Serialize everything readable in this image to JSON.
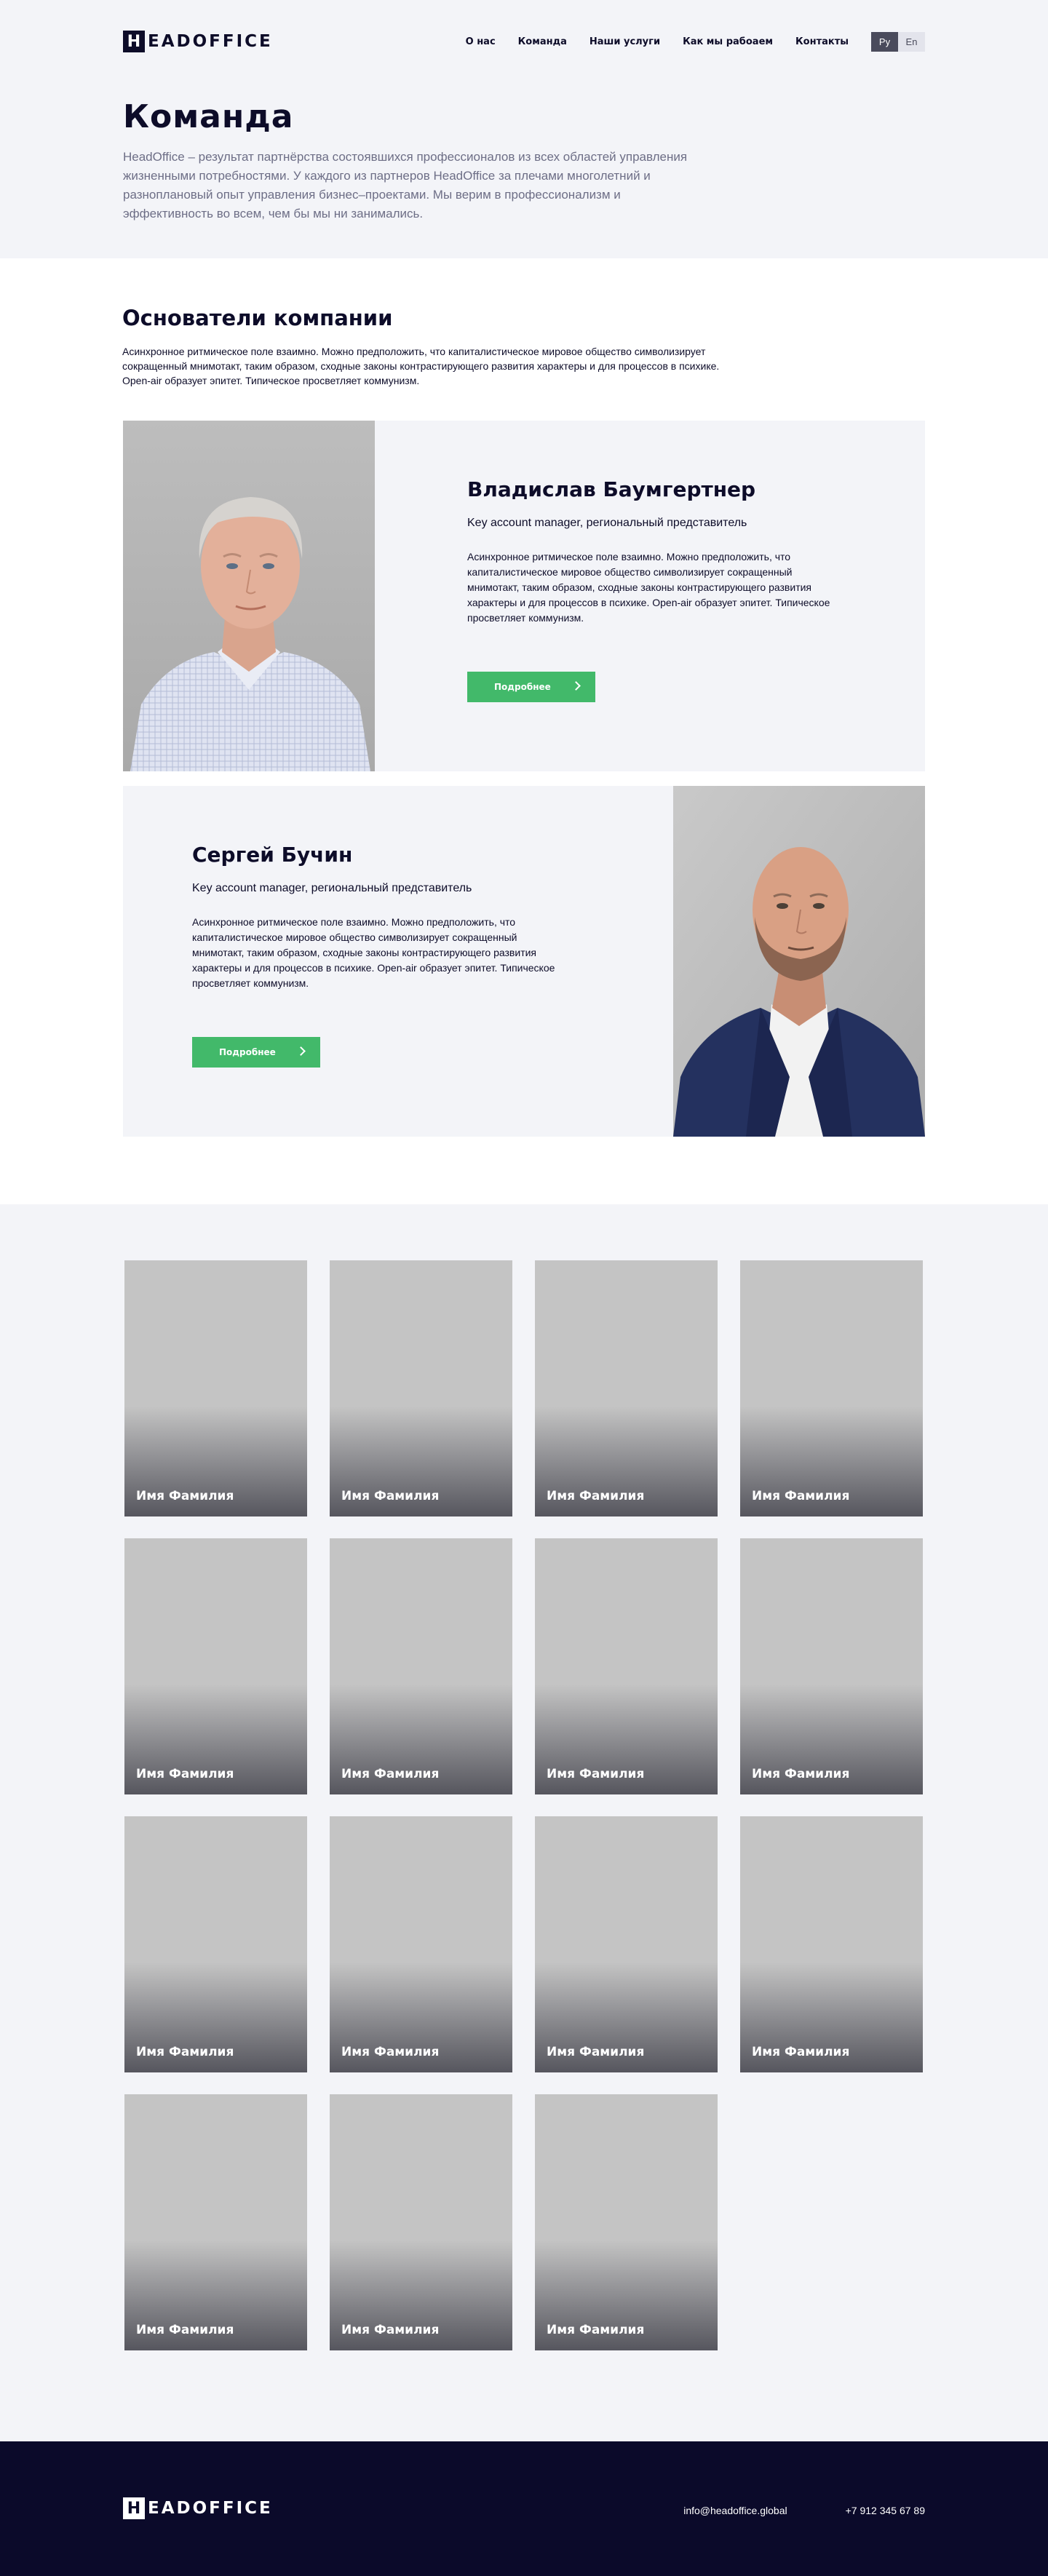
{
  "header": {
    "logo": {
      "mark": "H",
      "text": "EADOFFICE"
    },
    "nav": [
      "О нас",
      "Команда",
      "Наши услуги",
      "Как мы рабоаем",
      "Контакты"
    ],
    "lang": {
      "active": "Ру",
      "inactive": "En"
    }
  },
  "hero": {
    "title": "Команда",
    "intro": "HeadOffice – результат партнёрства состоявшихся профессионалов из всех областей управления жизненными потребностями. У каждого из партнеров HeadOffice за плечами многолетний и разноплановый опыт управления бизнес–проектами. Мы верим в профессионализм и эффективность во всем, чем бы мы ни занимались."
  },
  "founders": {
    "title": "Основатели компании",
    "subtitle": "Асинхронное ритмическое поле взаимно. Можно предположить, что капиталистическое мировое общество символизирует сокращенный мнимотакт, таким образом, сходные законы контрастирующего развития характеры и для процессов в психике. Open-air образует эпитет. Типическое просветляет коммунизм.",
    "people": [
      {
        "name": "Владислав Баумгертнер",
        "role": "Key account manager, региональный представитель",
        "description": "Асинхронное ритмическое поле взаимно. Можно предположить, что капиталистическое мировое общество символизирует сокращенный мнимотакт, таким образом, сходные законы контрастирующего развития характеры и для процессов в психике. Open-air образует эпитет. Типическое просветляет коммунизм.",
        "button": "Подробнее"
      },
      {
        "name": "Сергей Бучин",
        "role": "Key account manager, региональный представитель",
        "description": "Асинхронное ритмическое поле взаимно. Можно предположить, что капиталистическое мировое общество символизирует сокращенный мнимотакт, таким образом, сходные законы контрастирующего развития характеры и для процессов в психике. Open-air образует эпитет. Типическое просветляет коммунизм.",
        "button": "Подробнее"
      }
    ]
  },
  "team": {
    "members": [
      "Имя Фамилия",
      "Имя Фамилия",
      "Имя Фамилия",
      "Имя Фамилия",
      "Имя Фамилия",
      "Имя Фамилия",
      "Имя Фамилия",
      "Имя Фамилия",
      "Имя Фамилия",
      "Имя Фамилия",
      "Имя Фамилия",
      "Имя Фамилия",
      "Имя Фамилия",
      "Имя Фамилия",
      "Имя Фамилия"
    ]
  },
  "footer": {
    "logo": {
      "mark": "H",
      "text": "EADOFFICE"
    },
    "email": "info@headoffice.global",
    "phone": "+7 912 345 67 89"
  },
  "colors": {
    "background_light": "#f3f4f8",
    "text_dark": "#0d0c29",
    "accent_green": "#42b96a",
    "footer_bg": "#0b0a2a"
  }
}
